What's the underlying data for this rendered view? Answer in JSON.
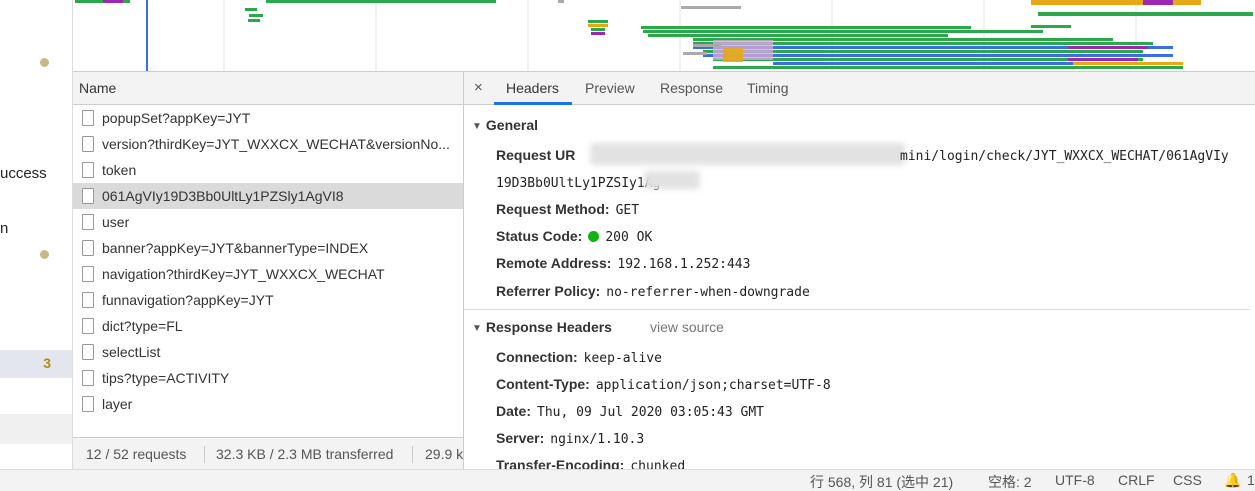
{
  "left_pane": {
    "text_1": "uccess",
    "text_2": "n",
    "badge": "3"
  },
  "request_list": {
    "header": "Name",
    "items": [
      "popupSet?appKey=JYT",
      "version?thirdKey=JYT_WXXCX_WECHAT&versionNo...",
      "token",
      "061AgVIy19D3Bb0UltLy1PZSly1AgVI8",
      "user",
      "banner?appKey=JYT&bannerType=INDEX",
      "navigation?thirdKey=JYT_WXXCX_WECHAT",
      "funnavigation?appKey=JYT",
      "dict?type=FL",
      "selectList",
      "tips?type=ACTIVITY",
      "layer"
    ],
    "selected_index": 3
  },
  "status_bar": {
    "requests": "12 / 52 requests",
    "transferred": "32.3 KB / 2.3 MB transferred",
    "resources": "29.9 k"
  },
  "tabs": {
    "close": "×",
    "items": [
      "Headers",
      "Preview",
      "Response",
      "Timing"
    ],
    "active": "Headers"
  },
  "general": {
    "title": "General",
    "request_url_label": "Request UR",
    "request_url_value": "mini/login/check/JYT_WXXCX_WECHAT/061AgVIy",
    "request_url_cont": "19D3Bb0UltLy1PZSIy1Ag",
    "method_label": "Request Method:",
    "method_value": "GET",
    "status_label": "Status Code:",
    "status_value": "200 OK",
    "status_color": "#10b310",
    "remote_label": "Remote Address:",
    "remote_value": "192.168.1.252:443",
    "referrer_label": "Referrer Policy:",
    "referrer_value": "no-referrer-when-downgrade"
  },
  "response_headers": {
    "title": "Response Headers",
    "view_source": "view source",
    "items": [
      {
        "k": "Connection:",
        "v": "keep-alive"
      },
      {
        "k": "Content-Type:",
        "v": "application/json;charset=UTF-8"
      },
      {
        "k": "Date:",
        "v": "Thu, 09 Jul 2020 03:05:43 GMT"
      },
      {
        "k": "Server:",
        "v": "nginx/1.10.3"
      },
      {
        "k": "Transfer-Encoding:",
        "v": "chunked"
      }
    ]
  },
  "editor_status": {
    "position": "行 568, 列 81 (选中 21)",
    "spaces": "空格: 2",
    "encoding": "UTF-8",
    "eol": "CRLF",
    "language": "CSS",
    "bell_icon": "bell-icon",
    "notif_count": "1"
  }
}
